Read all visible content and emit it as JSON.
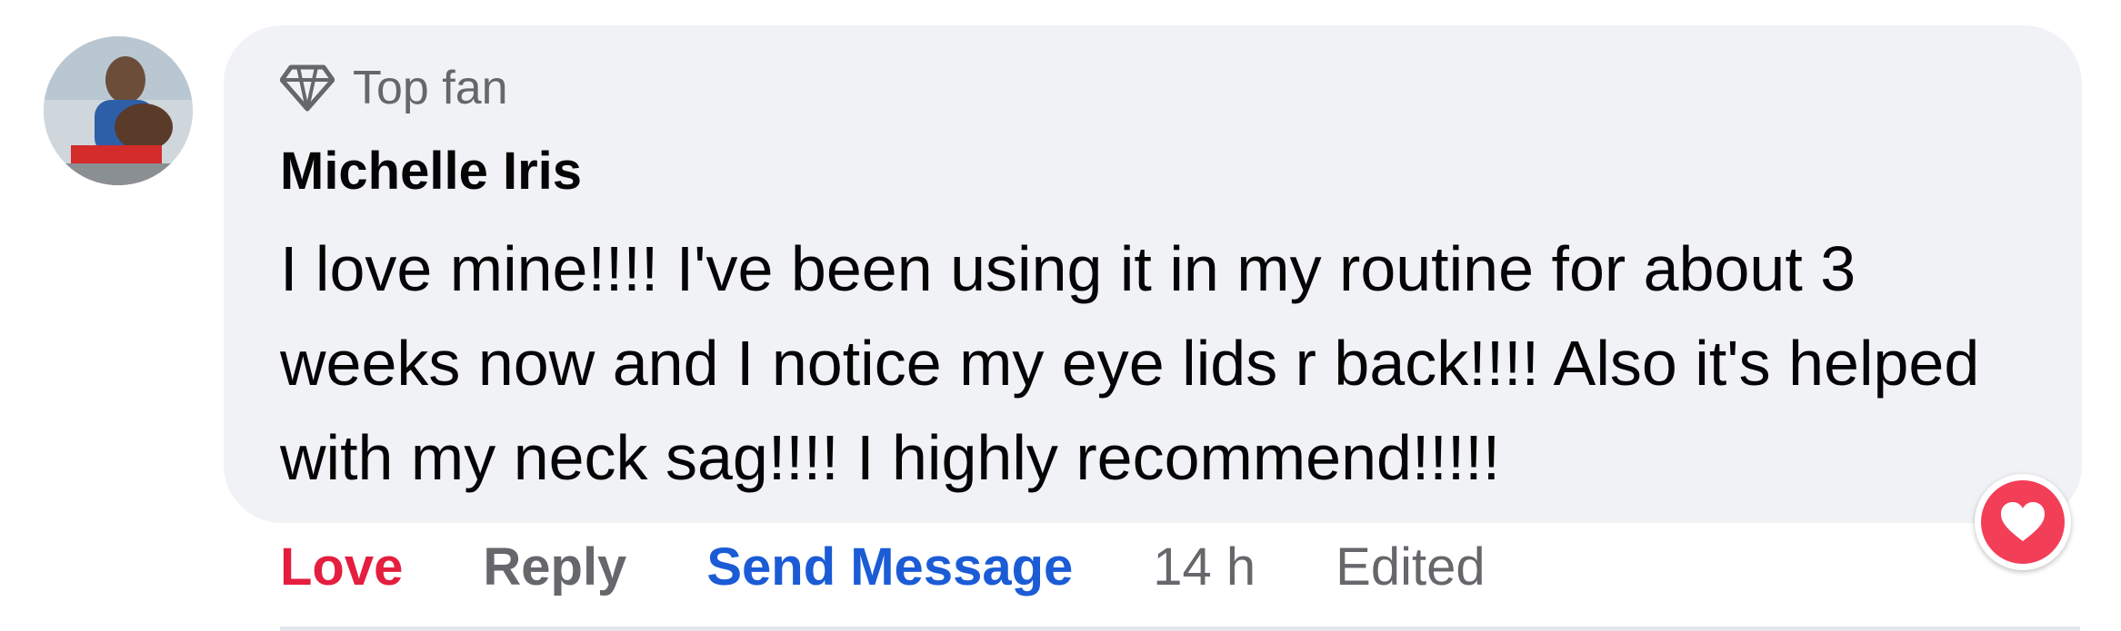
{
  "comment": {
    "badge_icon": "diamond-icon",
    "badge_label": "Top fan",
    "author": "Michelle Iris",
    "text": "I love mine!!!! I've been using it in my routine for about 3 weeks now and I notice my eye lids r back!!!! Also it's helped with my neck sag!!!! I highly recommend!!!!!",
    "actions": {
      "love": "Love",
      "reply": "Reply",
      "send_message": "Send Message",
      "time": "14 h",
      "edited": "Edited"
    },
    "reaction_icon": "heart-icon"
  },
  "colors": {
    "love": "#e41e3f",
    "link": "#1b5bd6",
    "muted": "#65676b",
    "bubble": "#f0f2f5",
    "reaction": "#f33e58"
  }
}
